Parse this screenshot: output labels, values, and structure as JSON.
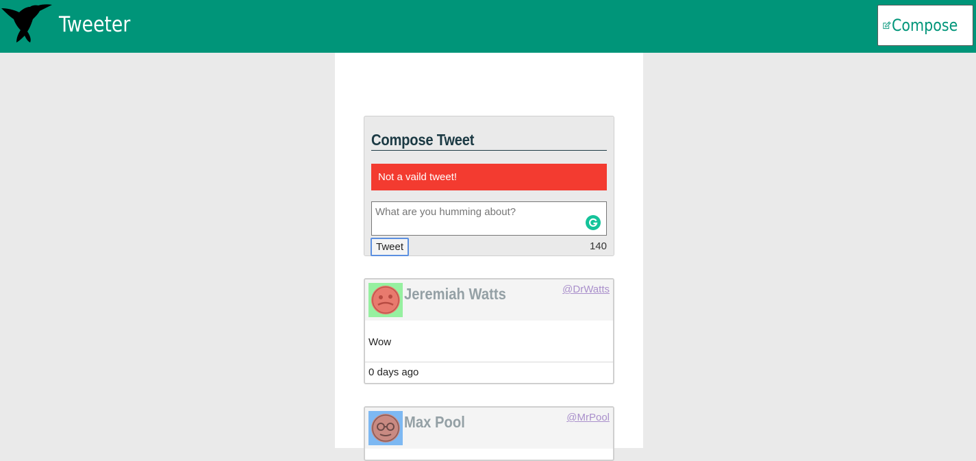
{
  "header": {
    "brand": "Tweeter",
    "compose_label": "Compose",
    "accent_color": "#009579"
  },
  "compose": {
    "title": "Compose Tweet",
    "error": "Not a vaild tweet!",
    "placeholder": "What are you humming about?",
    "value": "",
    "tweet_label": "Tweet",
    "counter": "140"
  },
  "tweets": [
    {
      "name": "Jeremiah Watts",
      "handle": "@DrWatts",
      "text": "Wow",
      "time": "0 days ago",
      "avatar_bg": "#96f0a0",
      "avatar_fg": "#e87a6e"
    },
    {
      "name": "Max Pool",
      "handle": "@MrPool",
      "text": "",
      "time": "",
      "avatar_bg": "#7db8f2",
      "avatar_fg": "#c98a82"
    }
  ]
}
